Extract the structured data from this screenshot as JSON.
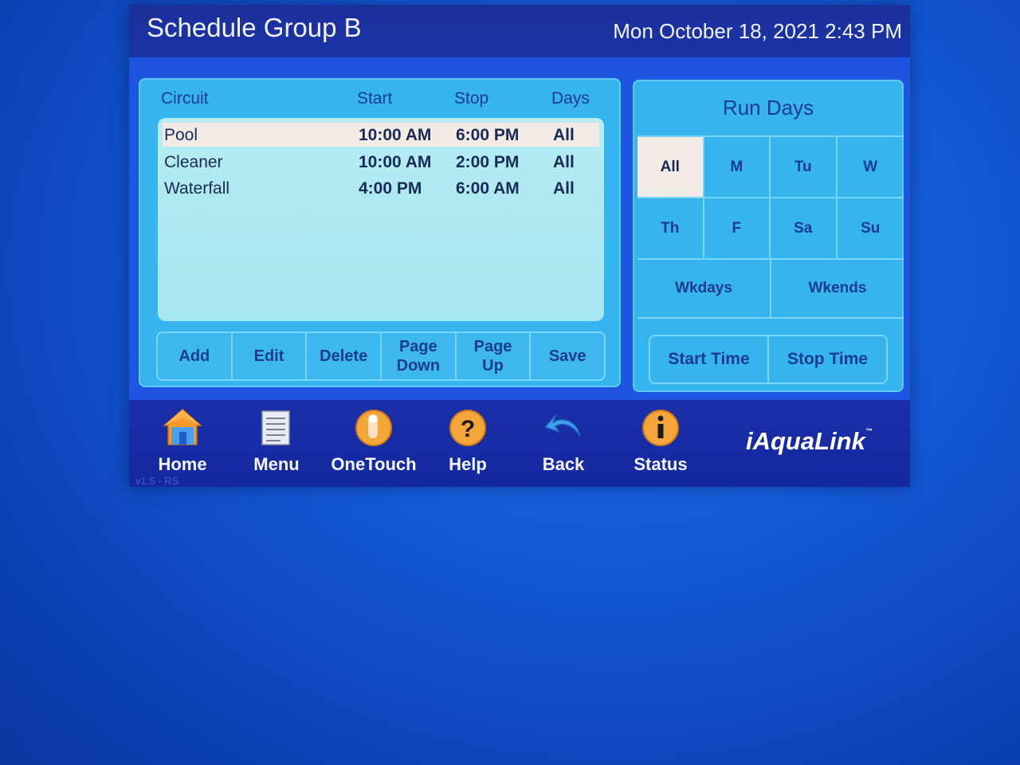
{
  "header": {
    "title": "Schedule Group B",
    "datetime": "Mon October 18, 2021 2:43 PM"
  },
  "schedule": {
    "columns": [
      "Circuit",
      "Start",
      "Stop",
      "Days"
    ],
    "rows": [
      {
        "circuit": "Pool",
        "start": "10:00 AM",
        "stop": "6:00 PM",
        "days": "All",
        "selected": true
      },
      {
        "circuit": "Cleaner",
        "start": "10:00 AM",
        "stop": "2:00 PM",
        "days": "All",
        "selected": false
      },
      {
        "circuit": "Waterfall",
        "start": "4:00 PM",
        "stop": "6:00 AM",
        "days": "All",
        "selected": false
      }
    ],
    "buttons": [
      "Add",
      "Edit",
      "Delete",
      "Page\nDown",
      "Page\nUp",
      "Save"
    ]
  },
  "run_days": {
    "title": "Run Days",
    "days": [
      "All",
      "M",
      "Tu",
      "W",
      "Th",
      "F",
      "Sa",
      "Su"
    ],
    "selected": "All",
    "groups": [
      "Wkdays",
      "Wkends"
    ],
    "time_buttons": [
      "Start Time",
      "Stop Time"
    ]
  },
  "nav": {
    "items": [
      "Home",
      "Menu",
      "OneTouch",
      "Help",
      "Back",
      "Status"
    ],
    "icons": [
      "house-icon",
      "menu-list-icon",
      "finger-touch-icon",
      "help-question-icon",
      "back-arrow-icon",
      "info-icon"
    ]
  },
  "brand": {
    "name": "iAquaLink",
    "tm": "™"
  },
  "version": "v1.5 - RS",
  "colors": {
    "panel": "#36b4ee",
    "list_bg": "#b6ecf2",
    "selected_bg": "#f3ebe4",
    "text_dark": "#1a3c8c",
    "nav_bg": "#1a2fa8"
  }
}
